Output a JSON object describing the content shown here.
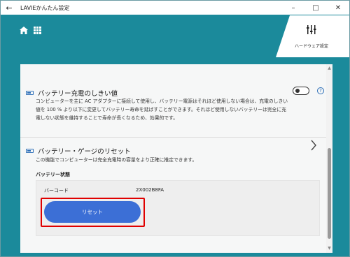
{
  "window": {
    "title": "LAVIEかんたん設定",
    "controls": [
      "–",
      "□",
      "✕"
    ]
  },
  "header": {
    "hardware_tile_label": "ハードウェア設定"
  },
  "battery_threshold": {
    "title": "バッテリー充電のしきい値",
    "description": "コンピューターを主に AC アダプターに接続して使用し、バッテリー電源はそれほど使用しない場合は、充電のしきい値を 100 % より以下に変更してバッテリー寿命を延ばすことができます。それほど使用しないバッテリーは完全に充電しない状態を維持することで寿命が長くなるため、効果的です。",
    "toggle_on": false,
    "help_glyph": "?"
  },
  "battery_gauge_reset": {
    "title": "バッテリー・ゲージのリセット",
    "description": "この機能でコンピューターは完全充電時の容量をより正確に推定できます。",
    "status_label": "バッテリー状態",
    "barcode_label": "バーコード",
    "barcode_value": "2X002B8FA",
    "reset_label": "リセット"
  },
  "icons": {
    "back": "arrow-left-icon",
    "home": "home-icon",
    "apps": "grid-icon",
    "hardware": "sliders-icon",
    "chevron": "chevron-right-icon"
  },
  "colors": {
    "teal_background": "#1b8a9b",
    "reset_button": "#3c6fd6",
    "highlight": "#e00000"
  }
}
